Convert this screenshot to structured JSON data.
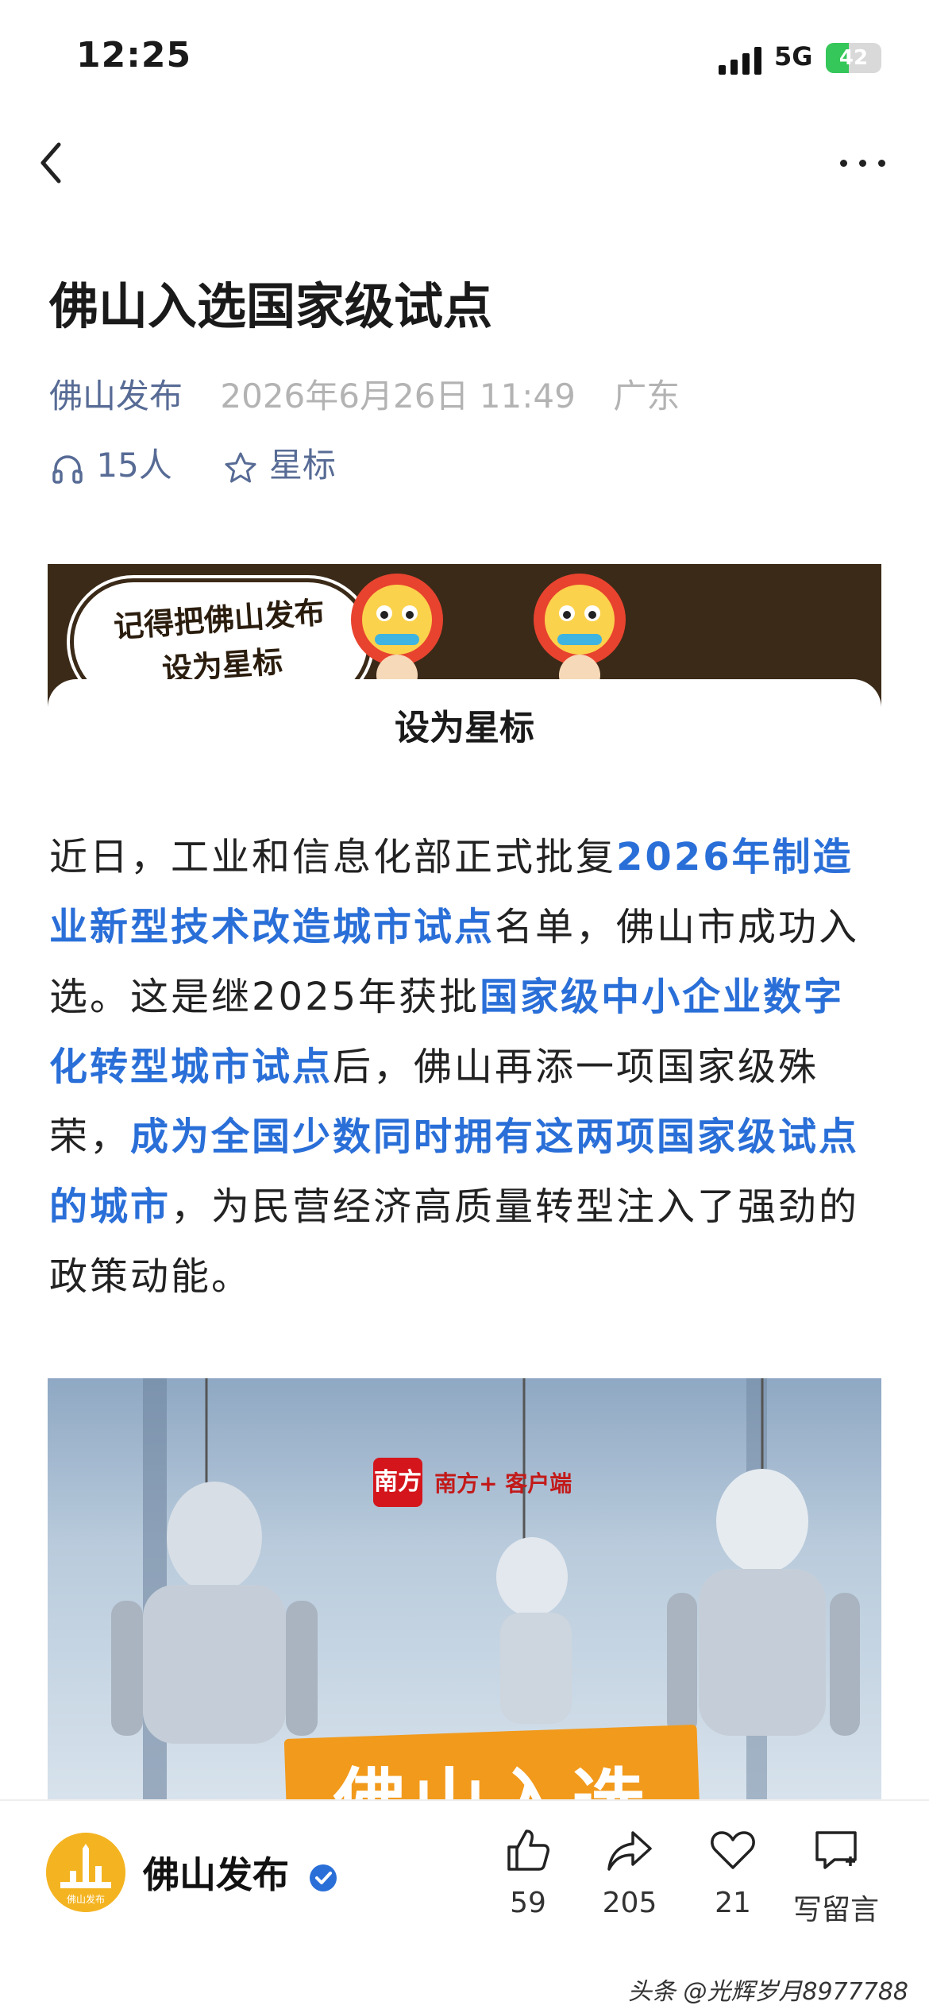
{
  "status_bar": {
    "time": "12:25",
    "network": "5G",
    "battery_level": "42",
    "battery_percent": 42
  },
  "article": {
    "title": "佛山入选国家级试点",
    "source": "佛山发布",
    "datetime": "2026年6月26日 11:49",
    "location": "广东",
    "listeners": "15人",
    "star_label": "星标",
    "body": [
      {
        "text": "近日，工业和信息化部正式批复",
        "highlight": false
      },
      {
        "text": "2026年制造业新型技术改造城市试点",
        "highlight": true
      },
      {
        "text": "名单，佛山市成功入选。这是继2025年获批",
        "highlight": false
      },
      {
        "text": "国家级中小企业数字化转型城市试点",
        "highlight": true
      },
      {
        "text": "后，佛山再添一项国家级殊荣，",
        "highlight": false
      },
      {
        "text": "成为全国少数同时拥有这两项国家级试点的城市",
        "highlight": true
      },
      {
        "text": "，为民营经济高质量转型注入了强劲的政策动能。",
        "highlight": false
      }
    ]
  },
  "banner": {
    "bubble_line1": "记得把佛山发布",
    "bubble_line2": "设为星标",
    "card_title": "设为星标"
  },
  "photo": {
    "logo_char": "南方",
    "logo_name": "南方+ 客户端",
    "banner_text": "佛山入选"
  },
  "bottom_bar": {
    "author": "佛山发布",
    "avatar_text": "佛山发布",
    "likes": "59",
    "shares": "205",
    "favorites": "21",
    "comment_label": "写留言"
  },
  "watermark": "头条 @光辉岁月8977788",
  "colors": {
    "link": "#576b95",
    "highlight": "#2a6fd8",
    "banner_bg": "#3b2a18",
    "accent_orange": "#f29a1c"
  }
}
